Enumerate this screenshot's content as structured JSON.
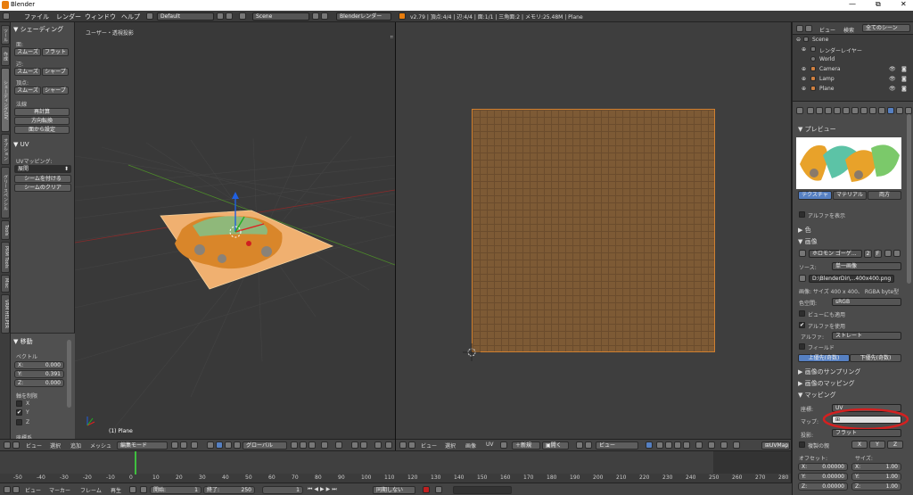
{
  "window": {
    "title": "Blender",
    "controls": [
      "—",
      "⧉",
      "✕"
    ]
  },
  "menubar": {
    "menus": [
      "ファイル",
      "レンダー",
      "ウィンドウ",
      "ヘルプ"
    ],
    "screen": "Default",
    "scene": "Scene",
    "engine": "Blenderレンダー",
    "stats": "v2.79 | 頂点:4/4 | 辺:4/4 | 面:1/1 | 三角面:2 | メモリ:25.48M | Plane"
  },
  "left_tabs": [
    "ツール",
    "作成",
    "シェーディング/UV",
    "オプション",
    "グリースペンシル",
    "Tools",
    "PRM Tools",
    "Misc",
    "VRM HELPER"
  ],
  "toolshelf": {
    "shading": {
      "title": "シェーディング",
      "face": "面:",
      "edge": "辺:",
      "vertex": "頂点:",
      "smooth": "スムーズ",
      "flat": "フラット",
      "sharp": "シャープ"
    },
    "normals": {
      "title": "法線",
      "recalc": "再計算",
      "flip": "方向転換",
      "from_face": "面から設定"
    },
    "uv": {
      "title": "UV",
      "mapping_label": "UVマッピング:",
      "unwrap": "展開",
      "mark_seam": "シームを付ける",
      "clear_seam": "シームのクリア"
    },
    "move": {
      "title": "移動",
      "vector": "ベクトル",
      "x_label": "X:",
      "x": "0.000",
      "y_label": "Y:",
      "y": "0.391",
      "z_label": "Z:",
      "z": "0.000",
      "constraint": "軸を制限",
      "cx": "X",
      "cy": "Y",
      "cz": "Z",
      "orientation": "座標系"
    }
  },
  "viewport3d": {
    "label": "ユーザー・透視投影",
    "object": "(1) Plane"
  },
  "header3d": {
    "view": "ビュー",
    "select": "選択",
    "add": "追加",
    "mesh": "メッシュ",
    "mode": "編集モード",
    "orientation": "グローバル"
  },
  "headeruv": {
    "view": "ビュー",
    "select": "選択",
    "image": "画像",
    "uv": "UV",
    "new": "新規",
    "open": "開く",
    "view2": "ビュー",
    "uvmap": "UVMap"
  },
  "timeline": {
    "ticks": [
      "-50",
      "-40",
      "-30",
      "-20",
      "-10",
      "0",
      "10",
      "20",
      "30",
      "40",
      "50",
      "60",
      "70",
      "80",
      "90",
      "100",
      "110",
      "120",
      "130",
      "140",
      "150",
      "160",
      "170",
      "180",
      "190",
      "200",
      "210",
      "220",
      "230",
      "240",
      "250",
      "260",
      "270",
      "280"
    ],
    "current_frame": 1,
    "view": "ビュー",
    "marker": "マーカー",
    "frame": "フレーム",
    "playback": "再生",
    "start_label": "開始:",
    "start": "1",
    "end_label": "終了:",
    "end": "250",
    "frame_value": "1",
    "sync": "同期しない"
  },
  "outliner": {
    "view": "ビュー",
    "search": "検索",
    "filter": "全てのシーン",
    "items": [
      {
        "label": "Scene",
        "indent": 0
      },
      {
        "label": "レンダーレイヤー",
        "indent": 1
      },
      {
        "label": "World",
        "indent": 1
      },
      {
        "label": "Camera",
        "indent": 1
      },
      {
        "label": "Lamp",
        "indent": 1
      },
      {
        "label": "Plane",
        "indent": 1
      }
    ]
  },
  "properties": {
    "preview": "プレビュー",
    "tabs": [
      "テクスチャ",
      "マテリアル",
      "両方"
    ],
    "show_alpha": "アルファを表示",
    "color": "色",
    "image_panel": "画像",
    "image_name": "ホロモン ゴーゲ...",
    "users": "2",
    "fake": "F",
    "source_label": "ソース:",
    "source": "単一画像",
    "filepath": "D:\\BlenderDir\\...400x400.png",
    "image_info": "画像: サイズ 400 x 400、 RGBA byte型",
    "colorspace_label": "色空間:",
    "colorspace": "sRGB",
    "view_as_render": "ビューにも適用",
    "use_alpha": "アルファを使用",
    "alpha_label": "アルファ:",
    "alpha_mode": "ストレート",
    "fields": "フィールド",
    "upper_first": "上優先(奇数)",
    "lower_first": "下優先(奇数)",
    "sampling": "画像のサンプリング",
    "image_mapping": "画像のマッピング",
    "mapping": "マッピング",
    "coords_label": "座標:",
    "coords": "UV",
    "map_label": "マップ:",
    "projection_label": "投影:",
    "projection": "フラット",
    "from_dupli": "複製の親",
    "offset": "オフセット:",
    "size": "サイズ:",
    "ox": "0.00000",
    "oy": "0.00000",
    "oz": "0.00000",
    "sx": "1.00",
    "sy": "1.00",
    "sz": "1.00",
    "x": "X:",
    "y": "Y:",
    "z": "Z:",
    "xyz": [
      "X",
      "Y",
      "Z"
    ]
  },
  "colors": {
    "accent": "#5680c2",
    "uv_fill": "#7d5a35",
    "highlight": "#d42020"
  }
}
